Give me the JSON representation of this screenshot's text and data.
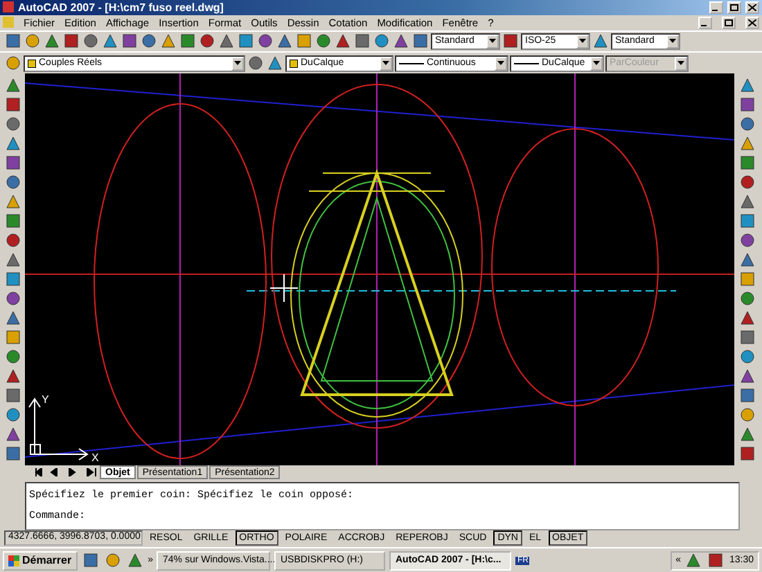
{
  "window": {
    "title": "AutoCAD 2007 - [H:\\cm7 fuso reel.dwg]"
  },
  "menu": [
    "Fichier",
    "Edition",
    "Affichage",
    "Insertion",
    "Format",
    "Outils",
    "Dessin",
    "Cotation",
    "Modification",
    "Fenêtre",
    "?"
  ],
  "styles": {
    "text_style": "Standard",
    "dim_style": "ISO-25",
    "table_style": "Standard"
  },
  "properties": {
    "layer": "Couples Réels",
    "color_setting": "DuCalque",
    "linetype": "Continuous",
    "lineweight": "DuCalque",
    "plot_style": {
      "value": "ParCouleur",
      "disabled": true
    }
  },
  "ucs": {
    "y_label": "Y",
    "x_label": "X"
  },
  "layout_tabs": [
    {
      "label": "Objet",
      "selected": true
    },
    {
      "label": "Présentation1",
      "selected": false
    },
    {
      "label": "Présentation2",
      "selected": false
    }
  ],
  "command_lines": [
    "Spécifiez le premier coin: Spécifiez le coin opposé:",
    "Commande:"
  ],
  "status_bar": {
    "coordinates": "4327.6666, 3996.8703, 0.0000",
    "toggles": [
      {
        "label": "RESOL",
        "on": false
      },
      {
        "label": "GRILLE",
        "on": false
      },
      {
        "label": "ORTHO",
        "on": true
      },
      {
        "label": "POLAIRE",
        "on": false
      },
      {
        "label": "ACCROBJ",
        "on": false
      },
      {
        "label": "REPEROBJ",
        "on": false
      },
      {
        "label": "SCUD",
        "on": false
      },
      {
        "label": "DYN",
        "on": true
      },
      {
        "label": "EL",
        "on": false
      },
      {
        "label": "OBJET",
        "on": true
      }
    ]
  },
  "taskbar": {
    "start": "Démarrer",
    "overflow": "»",
    "tasks": [
      {
        "label": "74% sur Windows.Vista....",
        "selected": false
      },
      {
        "label": "USBDISKPRO (H:)",
        "selected": false
      },
      {
        "label": "AutoCAD 2007 - [H:\\c...",
        "selected": true
      }
    ],
    "language": "FR",
    "tray_expand": "«",
    "clock": "13:30"
  }
}
